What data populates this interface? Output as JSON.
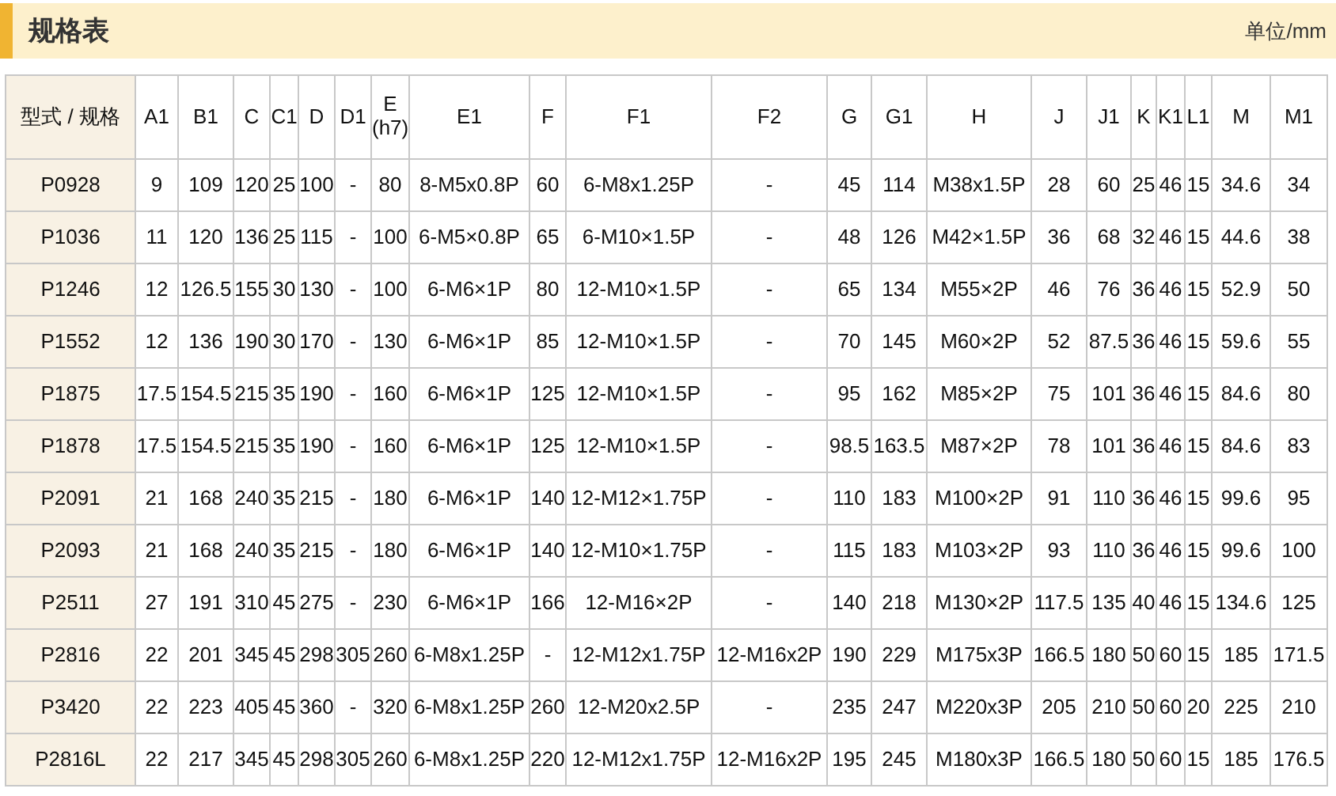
{
  "title": "规格表",
  "unit": "单位/mm",
  "columns": [
    {
      "label": "型式 / 规格"
    },
    {
      "label": "A1"
    },
    {
      "label": "B1"
    },
    {
      "label": "C"
    },
    {
      "label": "C1"
    },
    {
      "label": "D"
    },
    {
      "label": "D1"
    },
    {
      "label": "E",
      "sub": "(h7)"
    },
    {
      "label": "E1"
    },
    {
      "label": "F"
    },
    {
      "label": "F1"
    },
    {
      "label": "F2"
    },
    {
      "label": "G"
    },
    {
      "label": "G1"
    },
    {
      "label": "H"
    },
    {
      "label": "J"
    },
    {
      "label": "J1"
    },
    {
      "label": "K"
    },
    {
      "label": "K1"
    },
    {
      "label": "L1"
    },
    {
      "label": "M"
    },
    {
      "label": "M1"
    }
  ],
  "rows": [
    {
      "model": "P0928",
      "values": [
        "9",
        "109",
        "120",
        "25",
        "100",
        "-",
        "80",
        "8-M5x0.8P",
        "60",
        "6-M8x1.25P",
        "-",
        "45",
        "114",
        "M38x1.5P",
        "28",
        "60",
        "25",
        "46",
        "15",
        "34.6",
        "34"
      ]
    },
    {
      "model": "P1036",
      "values": [
        "11",
        "120",
        "136",
        "25",
        "115",
        "-",
        "100",
        "6-M5×0.8P",
        "65",
        "6-M10×1.5P",
        "-",
        "48",
        "126",
        "M42×1.5P",
        "36",
        "68",
        "32",
        "46",
        "15",
        "44.6",
        "38"
      ]
    },
    {
      "model": "P1246",
      "values": [
        "12",
        "126.5",
        "155",
        "30",
        "130",
        "-",
        "100",
        "6-M6×1P",
        "80",
        "12-M10×1.5P",
        "-",
        "65",
        "134",
        "M55×2P",
        "46",
        "76",
        "36",
        "46",
        "15",
        "52.9",
        "50"
      ]
    },
    {
      "model": "P1552",
      "values": [
        "12",
        "136",
        "190",
        "30",
        "170",
        "-",
        "130",
        "6-M6×1P",
        "85",
        "12-M10×1.5P",
        "-",
        "70",
        "145",
        "M60×2P",
        "52",
        "87.5",
        "36",
        "46",
        "15",
        "59.6",
        "55"
      ]
    },
    {
      "model": "P1875",
      "values": [
        "17.5",
        "154.5",
        "215",
        "35",
        "190",
        "-",
        "160",
        "6-M6×1P",
        "125",
        "12-M10×1.5P",
        "-",
        "95",
        "162",
        "M85×2P",
        "75",
        "101",
        "36",
        "46",
        "15",
        "84.6",
        "80"
      ]
    },
    {
      "model": "P1878",
      "values": [
        "17.5",
        "154.5",
        "215",
        "35",
        "190",
        "-",
        "160",
        "6-M6×1P",
        "125",
        "12-M10×1.5P",
        "-",
        "98.5",
        "163.5",
        "M87×2P",
        "78",
        "101",
        "36",
        "46",
        "15",
        "84.6",
        "83"
      ]
    },
    {
      "model": "P2091",
      "values": [
        "21",
        "168",
        "240",
        "35",
        "215",
        "-",
        "180",
        "6-M6×1P",
        "140",
        "12-M12×1.75P",
        "-",
        "110",
        "183",
        "M100×2P",
        "91",
        "110",
        "36",
        "46",
        "15",
        "99.6",
        "95"
      ]
    },
    {
      "model": "P2093",
      "values": [
        "21",
        "168",
        "240",
        "35",
        "215",
        "-",
        "180",
        "6-M6×1P",
        "140",
        "12-M10×1.75P",
        "-",
        "115",
        "183",
        "M103×2P",
        "93",
        "110",
        "36",
        "46",
        "15",
        "99.6",
        "100"
      ]
    },
    {
      "model": "P2511",
      "values": [
        "27",
        "191",
        "310",
        "45",
        "275",
        "-",
        "230",
        "6-M6×1P",
        "166",
        "12-M16×2P",
        "-",
        "140",
        "218",
        "M130×2P",
        "117.5",
        "135",
        "40",
        "46",
        "15",
        "134.6",
        "125"
      ]
    },
    {
      "model": "P2816",
      "values": [
        "22",
        "201",
        "345",
        "45",
        "298",
        "305",
        "260",
        "6-M8x1.25P",
        "-",
        "12-M12x1.75P",
        "12-M16x2P",
        "190",
        "229",
        "M175x3P",
        "166.5",
        "180",
        "50",
        "60",
        "15",
        "185",
        "171.5"
      ]
    },
    {
      "model": "P3420",
      "values": [
        "22",
        "223",
        "405",
        "45",
        "360",
        "-",
        "320",
        "6-M8x1.25P",
        "260",
        "12-M20x2.5P",
        "-",
        "235",
        "247",
        "M220x3P",
        "205",
        "210",
        "50",
        "60",
        "20",
        "225",
        "210"
      ]
    },
    {
      "model": "P2816L",
      "values": [
        "22",
        "217",
        "345",
        "45",
        "298",
        "305",
        "260",
        "6-M8x1.25P",
        "220",
        "12-M12x1.75P",
        "12-M16x2P",
        "195",
        "245",
        "M180x3P",
        "166.5",
        "180",
        "50",
        "60",
        "15",
        "185",
        "176.5"
      ]
    }
  ]
}
